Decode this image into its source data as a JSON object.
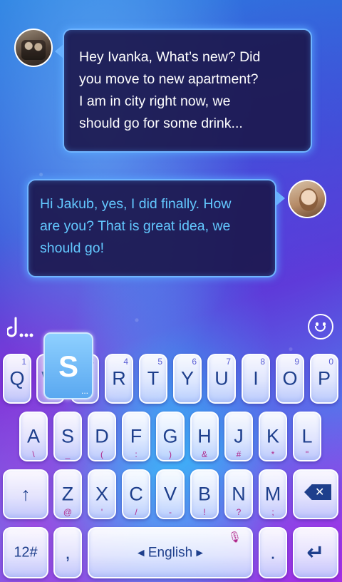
{
  "chat": {
    "message_received": "Hey Ivanka, What’s new? Did\nyou move to new apartment?\nI am in city right now, we\nshould go for some drink...",
    "message_sent": "Hi Jakub, yes, I did finally. How\nare you? That is great idea, we\nshould go!"
  },
  "keyboard": {
    "pressed_key": "S",
    "pressed_key_more": "...",
    "row1": [
      {
        "label": "Q",
        "sub": "1"
      },
      {
        "label": "W",
        "sub": "2"
      },
      {
        "label": "E",
        "sub": "3"
      },
      {
        "label": "R",
        "sub": "4"
      },
      {
        "label": "T",
        "sub": "5"
      },
      {
        "label": "Y",
        "sub": "6"
      },
      {
        "label": "U",
        "sub": "7"
      },
      {
        "label": "I",
        "sub": "8"
      },
      {
        "label": "O",
        "sub": "9"
      },
      {
        "label": "P",
        "sub": "0"
      }
    ],
    "row2": [
      {
        "label": "A",
        "bot": "\\"
      },
      {
        "label": "S",
        "bot": "_"
      },
      {
        "label": "D",
        "bot": "("
      },
      {
        "label": "F",
        "bot": ":"
      },
      {
        "label": "G",
        "bot": ")"
      },
      {
        "label": "H",
        "bot": "&"
      },
      {
        "label": "J",
        "bot": "#"
      },
      {
        "label": "K",
        "bot": "*"
      },
      {
        "label": "L",
        "bot": "\""
      }
    ],
    "row3": [
      {
        "label": "Z",
        "bot": "@"
      },
      {
        "label": "X",
        "bot": "'"
      },
      {
        "label": "C",
        "bot": "/"
      },
      {
        "label": "V",
        "bot": "-"
      },
      {
        "label": "B",
        "bot": "!"
      },
      {
        "label": "N",
        "bot": "?"
      },
      {
        "label": "M",
        "bot": ";"
      }
    ],
    "shift_icon": "↑",
    "delete_icon": "backspace-icon",
    "numbers_key": "12#",
    "comma_key": ",",
    "space_label": "◂ English ▸",
    "period_key": ".",
    "enter_icon": "↵",
    "mic_icon": "🎙"
  },
  "colors": {
    "key_text": "#1e3f8c",
    "symbol_text": "#b0288c",
    "bubble_border": "#6fb4ff",
    "sent_text": "#63c8ff"
  }
}
